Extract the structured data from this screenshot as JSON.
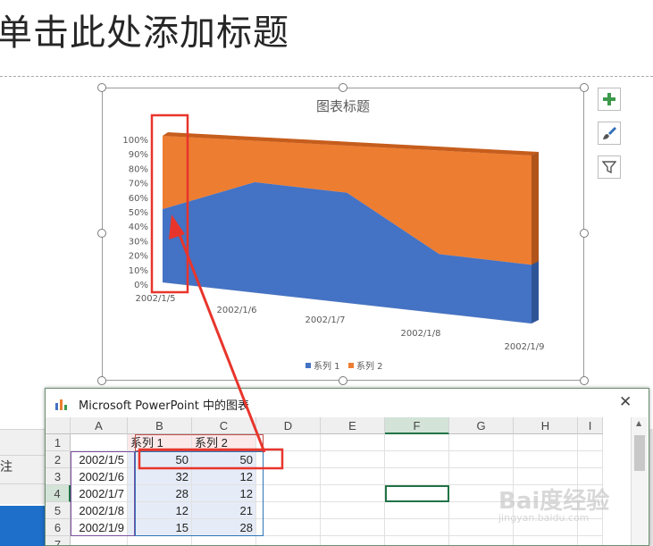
{
  "slide": {
    "title": "单击此处添加标题"
  },
  "chart_data": {
    "type": "area",
    "title": "图表标题",
    "categories": [
      "2002/1/5",
      "2002/1/6",
      "2002/1/7",
      "2002/1/8",
      "2002/1/9"
    ],
    "series": [
      {
        "name": "系列 1",
        "values": [
          50,
          32,
          28,
          12,
          15
        ],
        "color": "#4472C4"
      },
      {
        "name": "系列 2",
        "values": [
          50,
          12,
          12,
          21,
          28
        ],
        "color": "#ED7D31"
      }
    ],
    "stacked": "100%",
    "ylim": [
      0,
      100
    ],
    "yticks": [
      "100%",
      "90%",
      "80%",
      "70%",
      "60%",
      "50%",
      "40%",
      "30%",
      "20%",
      "10%",
      "0%"
    ],
    "legend": "bottom"
  },
  "side_buttons": [
    {
      "icon": "plus-icon"
    },
    {
      "icon": "brush-icon"
    },
    {
      "icon": "filter-icon"
    }
  ],
  "left_panel": {
    "label": "注"
  },
  "excel": {
    "title": "Microsoft PowerPoint 中的图表",
    "columns": [
      "A",
      "B",
      "C",
      "D",
      "E",
      "F",
      "G",
      "H",
      "I"
    ],
    "rows": [
      "1",
      "2",
      "3",
      "4",
      "5",
      "6",
      "7"
    ],
    "header_row": [
      "",
      "系列 1",
      "系列 2"
    ],
    "data": [
      [
        "2002/1/5",
        "50",
        "50"
      ],
      [
        "2002/1/6",
        "32",
        "12"
      ],
      [
        "2002/1/7",
        "28",
        "12"
      ],
      [
        "2002/1/8",
        "12",
        "21"
      ],
      [
        "2002/1/9",
        "15",
        "28"
      ]
    ]
  },
  "colors": {
    "annotation_red": "#e8352c",
    "selection_green": "#217346"
  }
}
